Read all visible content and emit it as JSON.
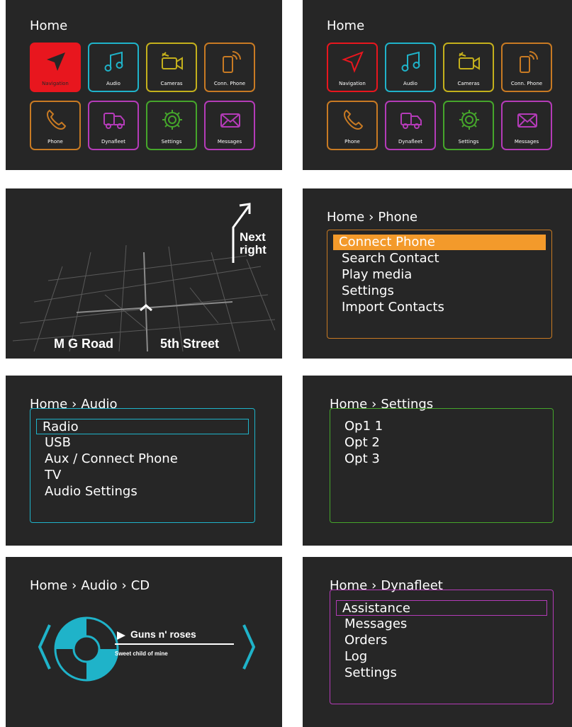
{
  "home": {
    "title": "Home",
    "tiles": [
      {
        "label": "Navigation",
        "icon": "navigation-arrow-icon",
        "color": "#e8161e"
      },
      {
        "label": "Audio",
        "icon": "music-note-icon",
        "color": "#1fb3c9"
      },
      {
        "label": "Cameras",
        "icon": "video-camera-icon",
        "color": "#c4b01c"
      },
      {
        "label": "Conn. Phone",
        "icon": "connected-phone-icon",
        "color": "#c87a23"
      },
      {
        "label": "Phone",
        "icon": "phone-handset-icon",
        "color": "#c87a23"
      },
      {
        "label": "Dynafleet",
        "icon": "truck-icon",
        "color": "#b43bb8"
      },
      {
        "label": "Settings",
        "icon": "gear-icon",
        "color": "#45a62b"
      },
      {
        "label": "Messages",
        "icon": "envelope-icon",
        "color": "#b43bb8"
      }
    ]
  },
  "navigation_screen": {
    "turn_line1": "Next",
    "turn_line2": "right",
    "street_left": "M G Road",
    "street_right": "5th Street"
  },
  "phone_screen": {
    "crumbs": [
      "Home",
      "Phone"
    ],
    "items": [
      "Connect Phone",
      "Search Contact",
      "Play media",
      "Settings",
      "Import Contacts"
    ],
    "accent": "#c87a23",
    "highlight": "#f39a2b"
  },
  "audio_screen": {
    "crumbs": [
      "Home",
      "Audio"
    ],
    "items": [
      "Radio",
      "USB",
      "Aux / Connect Phone",
      "TV",
      "Audio Settings"
    ],
    "accent": "#1fb3c9"
  },
  "settings_screen": {
    "crumbs": [
      "Home",
      "Settings"
    ],
    "items": [
      "Op1 1",
      "Opt 2",
      "Opt 3"
    ],
    "accent": "#45a62b"
  },
  "cd_screen": {
    "crumbs": [
      "Home",
      "Audio",
      "CD"
    ],
    "track_artist": "Guns n' roses",
    "track_song": "Sweet child of mine",
    "accent": "#1fb3c9"
  },
  "dynafleet_screen": {
    "crumbs": [
      "Home",
      "Dynafleet"
    ],
    "items": [
      "Assistance",
      "Messages",
      "Orders",
      "Log",
      "Settings"
    ],
    "accent": "#b43bb8"
  }
}
